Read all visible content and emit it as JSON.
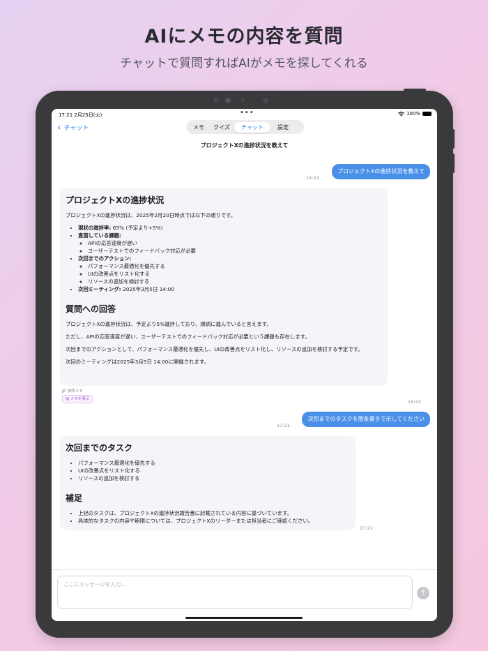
{
  "hero": {
    "title": "AIにメモの内容を質問",
    "subtitle": "チャットで質問すればAIがメモを探してくれる"
  },
  "status_bar": {
    "time": "17:21  2月25日(火)",
    "dots": "•••",
    "battery": "100%",
    "wifi_icon": "wifi-icon"
  },
  "nav": {
    "back_label": "チャット",
    "tabs": [
      {
        "label": "メモ",
        "active": false
      },
      {
        "label": "クイズ",
        "active": false
      },
      {
        "label": "チャット",
        "active": true
      },
      {
        "label": "設定",
        "active": false
      }
    ],
    "title": "プロジェクトXの進捗状況を教えて"
  },
  "messages": {
    "user1": {
      "text": "プロジェクトXの進捗状況を教えて",
      "time": "16:53"
    },
    "ai1": {
      "heading1": "プロジェクトXの進捗状況",
      "intro": "プロジェクトXの進捗状況は、2025年2月20日時点では以下の通りです。",
      "progress_label": "現状の進捗率:",
      "progress_value": " 65% (予定より+5%)",
      "issues_label": "直面している課題:",
      "issues": [
        "APIの応答速度が遅い",
        "ユーザーテストでのフィードバック対応が必要"
      ],
      "actions_label": "次回までのアクション:",
      "actions": [
        "パフォーマンス最適化を優先する",
        "UIの改善点をリスト化する",
        "リソースの追加を検討する"
      ],
      "meeting_label": "次回ミーティング:",
      "meeting_value": " 2025年3月5日 14:00",
      "heading2": "質問への回答",
      "answer1": "プロジェクトXの進捗状況は、予定より5%進捗しており、順調に進んでいると言えます。",
      "answer2": "ただし、APIの応答速度が遅い、ユーザーテストでのフィードバック対応が必要という課題も存在します。",
      "answer3": "次回までのアクションとして、パフォーマンス最適化を優先し、UIの改善点をリスト化し、リソースの追加を検討する予定です。",
      "answer4": "次回のミーティングは2025年3月5日 14:00に開催されます。",
      "ref_label": "参照メモ",
      "memo_button": "メモを表示",
      "time": "16:53"
    },
    "user2": {
      "text": "次回までのタスクを箇条書きで示してください",
      "time": "17:21"
    },
    "ai2": {
      "heading1": "次回までのタスク",
      "tasks": [
        "パフォーマンス最適化を優先する",
        "UIの改善点をリスト化する",
        "リソースの追加を検討する"
      ],
      "heading2": "補足",
      "notes": [
        "上記のタスクは、プロジェクトXの進捗状況報告書に記載されている内容に基づいています。",
        "具体的なタスクの内容や期限については、プロジェクトXのリーダーまたは担当者にご確認ください。"
      ],
      "time": "17:21"
    }
  },
  "composer": {
    "placeholder": "ここにメッセージを入力...",
    "send_icon": "arrow-up-icon"
  }
}
